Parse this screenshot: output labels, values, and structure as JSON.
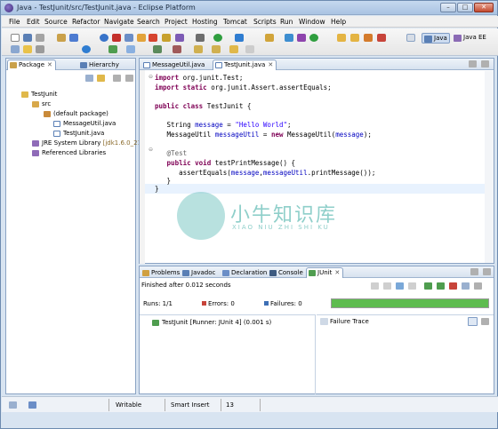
{
  "window": {
    "title": "Java - TestJunit/src/TestJunit.java - Eclipse Platform",
    "min": "–",
    "max": "□",
    "close": "✕"
  },
  "menu": [
    "File",
    "Edit",
    "Source",
    "Refactor",
    "Navigate",
    "Search",
    "Project",
    "Hosting",
    "Tomcat",
    "Scripts",
    "Run",
    "Window",
    "Help"
  ],
  "perspectives": {
    "java": "Java",
    "javaee": "Java EE"
  },
  "explorer": {
    "tabs": {
      "package": "Package",
      "hierarchy": "Hierarchy"
    },
    "tree": {
      "project": "TestJunit",
      "src": "src",
      "pkg": "(default package)",
      "file1": "MessageUtil.java",
      "file2": "TestJunit.java",
      "jre": "JRE System Library",
      "jre_ver": "[jdk1.6.0_21]",
      "libs": "Referenced Libraries"
    }
  },
  "editor": {
    "tabs": {
      "t1": "MessageUtil.java",
      "t2": "TestJunit.java"
    },
    "lines": {
      "l1a": "import",
      "l1b": " org.junit.Test;",
      "l2a": "import static",
      "l2b": " org.junit.Assert.assertEquals;",
      "l4a": "public class",
      "l4b": " TestJunit {",
      "l6a": "   String ",
      "l6b": "message",
      "l6c": " = ",
      "l6d": "\"Hello World\"",
      "l6e": ";",
      "l7a": "   MessageUtil ",
      "l7b": "messageUtil",
      "l7c": " = ",
      "l7d": "new",
      "l7e": " MessageUtil(",
      "l7f": "message",
      "l7g": ");",
      "l9": "   @Test",
      "l10a": "   public void",
      "l10b": " testPrintMessage() {",
      "l11a": "      assertEquals(",
      "l11b": "message",
      "l11c": ",",
      "l11d": "messageUtil",
      "l11e": ".printMessage());",
      "l12": "   }",
      "l13": "}"
    }
  },
  "watermark": {
    "cn": "小牛知识库",
    "en": "XIAO NIU ZHI SHI KU"
  },
  "bottom": {
    "tabs": {
      "problems": "Problems",
      "javadoc": "Javadoc",
      "declaration": "Declaration",
      "console": "Console",
      "junit": "JUnit"
    },
    "finished": "Finished after 0.012 seconds",
    "runs_label": "Runs:",
    "runs": "1/1",
    "errors_label": "Errors:",
    "errors": "0",
    "failures_label": "Failures:",
    "failures": "0",
    "progress": 1.0,
    "bar_color": "#5ebc4f",
    "result": "TestJunit [Runner: JUnit 4] (0.001 s)",
    "failure_trace": "Failure Trace"
  },
  "status": {
    "writable": "Writable",
    "insert": "Smart Insert",
    "pos": "13"
  }
}
